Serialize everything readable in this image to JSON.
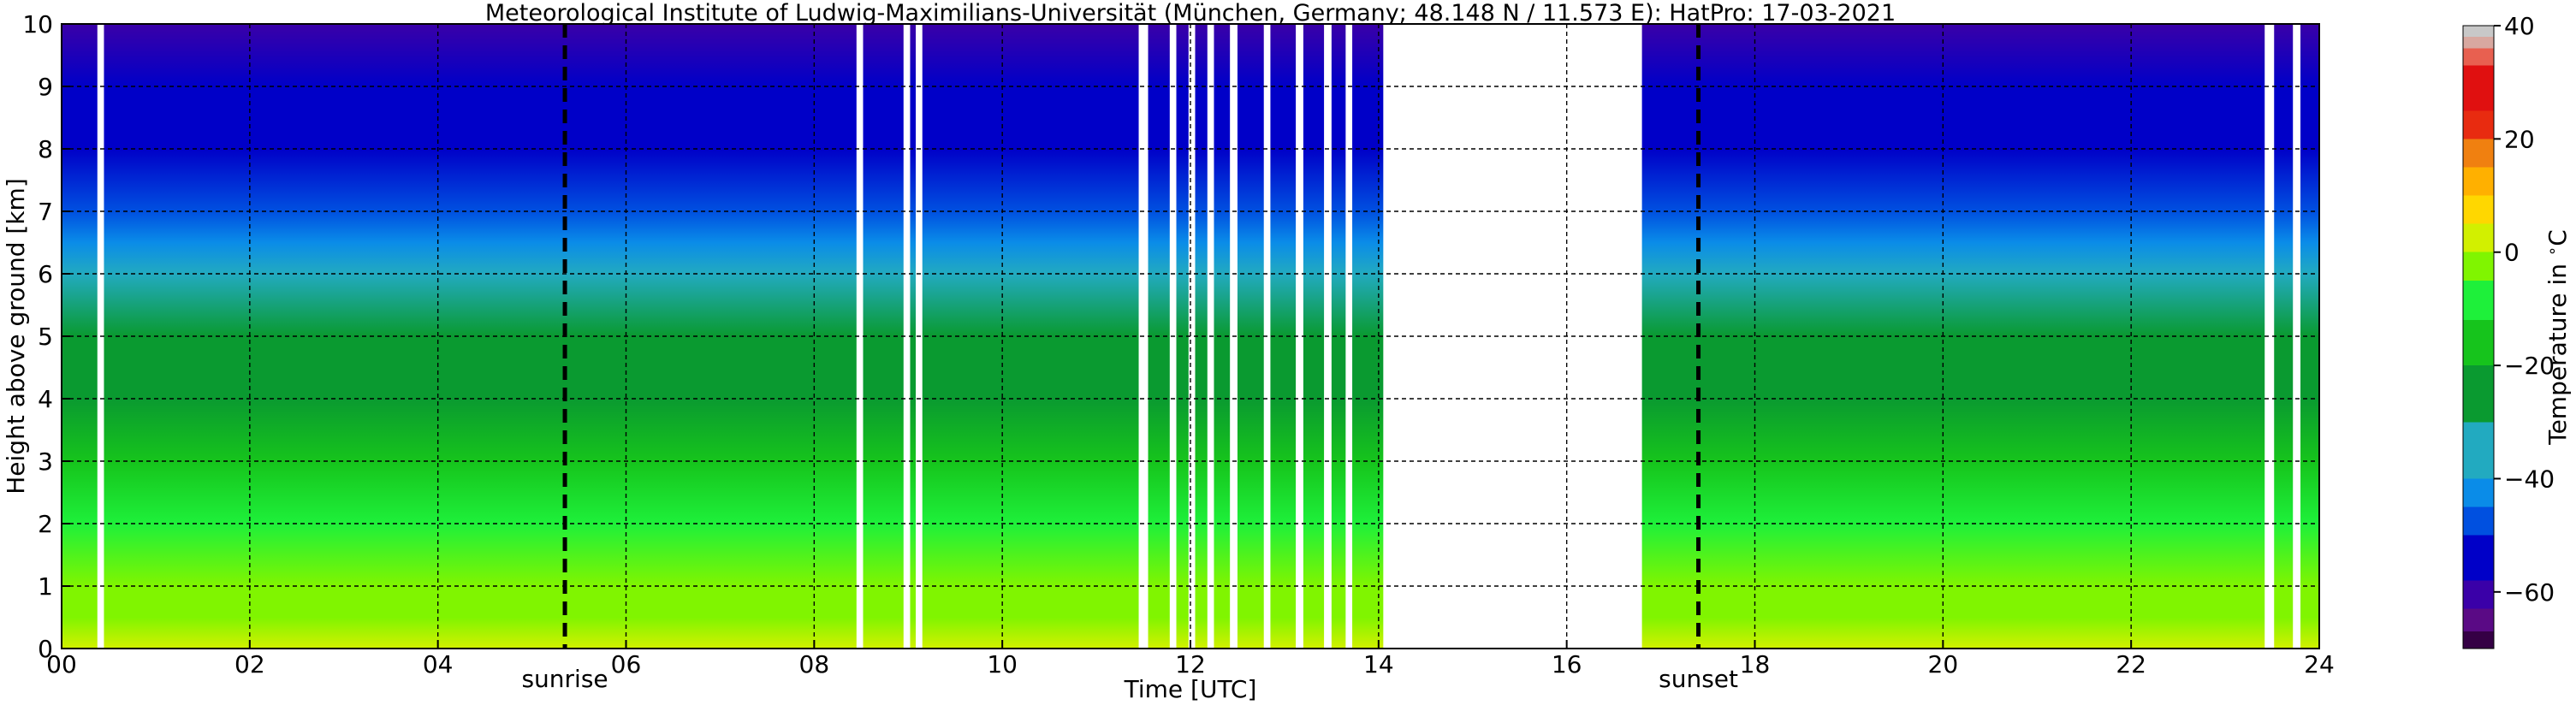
{
  "chart_data": {
    "type": "heatmap",
    "title": "Meteorological Institute of Ludwig-Maximilians-Universität (München, Germany; 48.148 N / 11.573 E):    HatPro: 17-03-2021",
    "xlabel": "Time [UTC]",
    "ylabel": "Height above ground [km]",
    "xlim": [
      0,
      24
    ],
    "ylim": [
      0,
      10
    ],
    "x_ticks": [
      {
        "value": 0,
        "label": "00"
      },
      {
        "value": 2,
        "label": "02"
      },
      {
        "value": 4,
        "label": "04"
      },
      {
        "value": 6,
        "label": "06"
      },
      {
        "value": 8,
        "label": "08"
      },
      {
        "value": 10,
        "label": "10"
      },
      {
        "value": 12,
        "label": "12"
      },
      {
        "value": 14,
        "label": "14"
      },
      {
        "value": 16,
        "label": "16"
      },
      {
        "value": 18,
        "label": "18"
      },
      {
        "value": 20,
        "label": "20"
      },
      {
        "value": 22,
        "label": "22"
      },
      {
        "value": 24,
        "label": "24"
      }
    ],
    "y_ticks": [
      0,
      1,
      2,
      3,
      4,
      5,
      6,
      7,
      8,
      9,
      10
    ],
    "grid": true,
    "events": [
      {
        "label": "sunrise",
        "time": 5.35
      },
      {
        "label": "sunset",
        "time": 17.4
      }
    ],
    "colorbar": {
      "label": "Temperature in $^\\circ$C",
      "range": [
        -70,
        40
      ],
      "ticks": [
        -60,
        -40,
        -20,
        0,
        20,
        40
      ],
      "levels": [
        {
          "t": -70,
          "color": "#0a0a0a"
        },
        {
          "t": -67,
          "color": "#350045"
        },
        {
          "t": -63,
          "color": "#5a0a85"
        },
        {
          "t": -58,
          "color": "#3a00a8"
        },
        {
          "t": -50,
          "color": "#0000c8"
        },
        {
          "t": -45,
          "color": "#0050e0"
        },
        {
          "t": -40,
          "color": "#0a8ce8"
        },
        {
          "t": -30,
          "color": "#22aac0"
        },
        {
          "t": -20,
          "color": "#0a9a30"
        },
        {
          "t": -12,
          "color": "#16c41c"
        },
        {
          "t": -5,
          "color": "#1ef03a"
        },
        {
          "t": 0,
          "color": "#80f500"
        },
        {
          "t": 5,
          "color": "#d2f000"
        },
        {
          "t": 10,
          "color": "#ffd700"
        },
        {
          "t": 15,
          "color": "#ffb000"
        },
        {
          "t": 20,
          "color": "#f08010"
        },
        {
          "t": 25,
          "color": "#e82b10"
        },
        {
          "t": 33,
          "color": "#e01010"
        },
        {
          "t": 36,
          "color": "#e86050"
        },
        {
          "t": 38,
          "color": "#d8a8a0"
        },
        {
          "t": 40,
          "color": "#c8c8c8"
        }
      ]
    },
    "temperature_profile": [
      {
        "height_km": 0.0,
        "celsius": 5
      },
      {
        "height_km": 0.5,
        "celsius": 0
      },
      {
        "height_km": 1.0,
        "celsius": -3
      },
      {
        "height_km": 2.0,
        "celsius": -8
      },
      {
        "height_km": 3.0,
        "celsius": -14
      },
      {
        "height_km": 4.0,
        "celsius": -20
      },
      {
        "height_km": 5.0,
        "celsius": -28
      },
      {
        "height_km": 6.0,
        "celsius": -36
      },
      {
        "height_km": 6.5,
        "celsius": -42
      },
      {
        "height_km": 7.0,
        "celsius": -46
      },
      {
        "height_km": 8.0,
        "celsius": -52
      },
      {
        "height_km": 9.0,
        "celsius": -55
      },
      {
        "height_km": 10.0,
        "celsius": -58
      }
    ],
    "data_gaps": [
      {
        "start": 0.38,
        "end": 0.45
      },
      {
        "start": 8.45,
        "end": 8.52
      },
      {
        "start": 8.95,
        "end": 9.02
      },
      {
        "start": 9.08,
        "end": 9.15
      },
      {
        "start": 11.45,
        "end": 11.55
      },
      {
        "start": 11.78,
        "end": 11.85
      },
      {
        "start": 11.98,
        "end": 12.05
      },
      {
        "start": 12.18,
        "end": 12.25
      },
      {
        "start": 12.42,
        "end": 12.5
      },
      {
        "start": 12.78,
        "end": 12.85
      },
      {
        "start": 13.12,
        "end": 13.2
      },
      {
        "start": 13.42,
        "end": 13.5
      },
      {
        "start": 13.65,
        "end": 13.72
      },
      {
        "start": 14.05,
        "end": 16.8
      },
      {
        "start": 23.42,
        "end": 23.52
      },
      {
        "start": 23.72,
        "end": 23.8
      }
    ]
  }
}
